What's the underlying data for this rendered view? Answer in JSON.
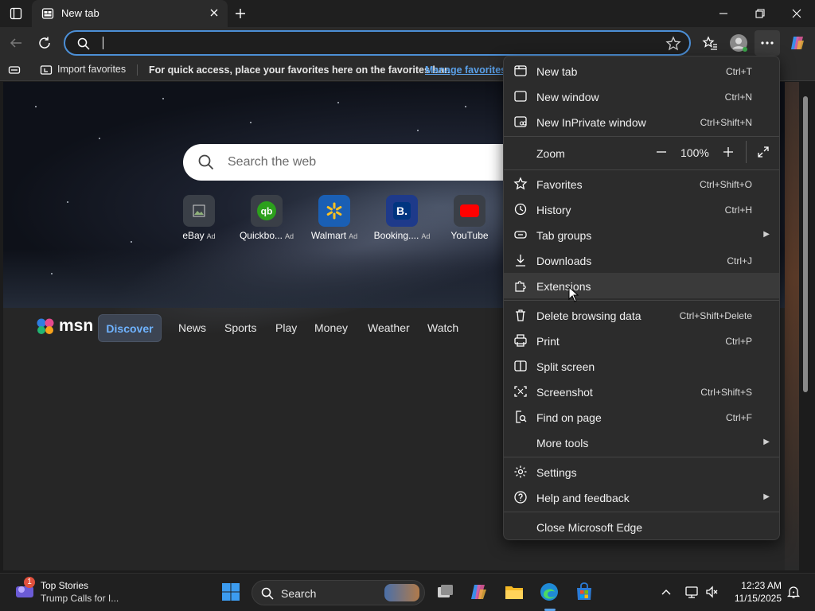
{
  "tab": {
    "title": "New tab"
  },
  "toolbar": {
    "address_value": ""
  },
  "favorites_bar": {
    "import_label": "Import favorites",
    "message": "For quick access, place your favorites here on the favorites bar.",
    "manage_link": "Manage favorites..."
  },
  "newtab": {
    "search_placeholder": "Search the web",
    "tiles": [
      {
        "label": "eBay",
        "ad": "Ad"
      },
      {
        "label": "Quickbo...",
        "ad": "Ad"
      },
      {
        "label": "Walmart",
        "ad": "Ad"
      },
      {
        "label": "Booking....",
        "ad": "Ad"
      },
      {
        "label": "YouTube",
        "ad": ""
      }
    ],
    "msn": {
      "logo": "msn",
      "nav": [
        "Discover",
        "News",
        "Sports",
        "Play",
        "Money",
        "Weather",
        "Watch"
      ]
    }
  },
  "menu": {
    "items": [
      {
        "label": "New tab",
        "shortcut": "Ctrl+T"
      },
      {
        "label": "New window",
        "shortcut": "Ctrl+N"
      },
      {
        "label": "New InPrivate window",
        "shortcut": "Ctrl+Shift+N"
      },
      {
        "label": "Zoom",
        "value": "100%"
      },
      {
        "label": "Favorites",
        "shortcut": "Ctrl+Shift+O"
      },
      {
        "label": "History",
        "shortcut": "Ctrl+H"
      },
      {
        "label": "Tab groups",
        "shortcut": ""
      },
      {
        "label": "Downloads",
        "shortcut": "Ctrl+J"
      },
      {
        "label": "Extensions",
        "shortcut": ""
      },
      {
        "label": "Delete browsing data",
        "shortcut": "Ctrl+Shift+Delete"
      },
      {
        "label": "Print",
        "shortcut": "Ctrl+P"
      },
      {
        "label": "Split screen",
        "shortcut": ""
      },
      {
        "label": "Screenshot",
        "shortcut": "Ctrl+Shift+S"
      },
      {
        "label": "Find on page",
        "shortcut": "Ctrl+F"
      },
      {
        "label": "More tools",
        "shortcut": ""
      },
      {
        "label": "Settings",
        "shortcut": ""
      },
      {
        "label": "Help and feedback",
        "shortcut": ""
      },
      {
        "label": "Close Microsoft Edge",
        "shortcut": ""
      }
    ]
  },
  "taskbar": {
    "news_badge": "1",
    "news_title": "Top Stories",
    "news_subtitle": "Trump Calls for I...",
    "search_label": "Search",
    "time": "12:23 AM",
    "date": "11/15/2025"
  },
  "colors": {
    "accent": "#5aa0e8",
    "menu_bg": "#2c2c2c",
    "discover": "#6fb3ff"
  }
}
